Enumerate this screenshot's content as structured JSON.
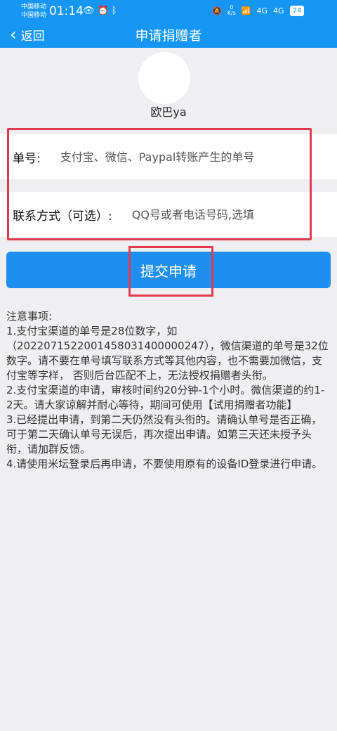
{
  "status_bar": {
    "carrier_1": "中国移动",
    "carrier_2": "中国移动",
    "time": "01:14",
    "icons_left": [
      "eye-icon",
      "alarm-icon",
      "bluetooth-icon"
    ],
    "mute_glyph": "🔕",
    "speed_value": "0",
    "speed_unit": "K/s",
    "wifi_glyph": "📶",
    "signal_1": "4G",
    "signal_2": "4G",
    "battery": "74"
  },
  "nav": {
    "back_label": "返回",
    "title": "申请捐赠者"
  },
  "user": {
    "name": "欧巴ya"
  },
  "form": {
    "order_label": "单号:",
    "order_placeholder": "支付宝、微信、Paypal转账产生的单号",
    "contact_label": "联系方式（可选）:",
    "contact_placeholder": "QQ号或者电话号码,选填",
    "submit_label": "提交申请"
  },
  "notes": {
    "title": "注意事项:",
    "items": [
      "1.支付宝渠道的单号是28位数字，如（2022071522001458031400000247），微信渠道的单号是32位数字。请不要在单号填写联系方式等其他内容，也不需要加微信，支付宝等字样， 否则后台匹配不上，无法授权捐赠者头衔。",
      "2.支付宝渠道的申请，审核时间约20分钟-1个小时。微信渠道的约1-2天。请大家谅解并耐心等待，期间可使用【试用捐赠者功能】",
      "3.已经提出申请，到第二天仍然没有头衔的。请确认单号是否正确，可于第二天确认单号无误后，再次提出申请。如第三天还未授予头衔，请加群反馈。",
      "4.请使用米坛登录后再申请，不要使用原有的设备ID登录进行申请。"
    ]
  },
  "colors": {
    "primary": "#1596f2",
    "button": "#1e8ff0",
    "highlight": "#e13a4f",
    "background": "#efeff1"
  }
}
